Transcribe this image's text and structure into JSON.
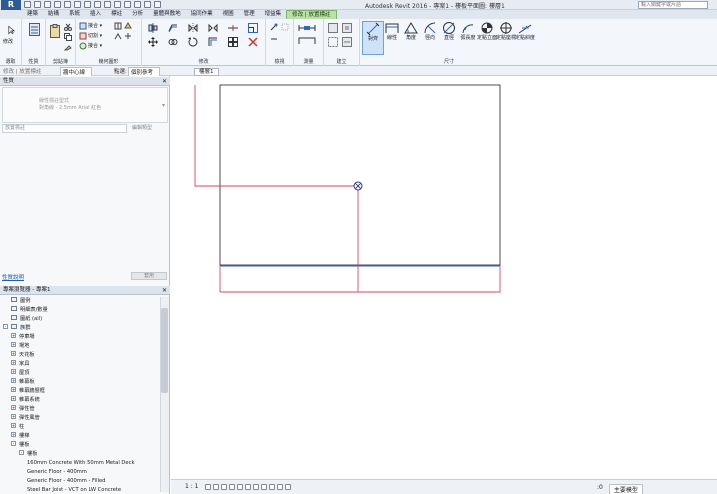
{
  "app": {
    "logo": "R",
    "title": "Autodesk Revit 2016 -    專案1 - 樓板平面圖: 樓層1",
    "search_placeholder": "輸入關鍵字或片語"
  },
  "ribbon_tabs": [
    "建築",
    "結構",
    "系統",
    "插入",
    "標註",
    "分析",
    "量體與敷地",
    "協同作業",
    "視圖",
    "管理",
    "增益集",
    "修改 | 放置標註"
  ],
  "ribbon_groups": {
    "select": "選取",
    "properties": "性質",
    "clipboard": "剪貼簿",
    "geometry": "幾何圖形",
    "modify": "修改",
    "view": "檢視",
    "measure": "測量",
    "create": "建立",
    "dimension": "尺寸"
  },
  "ribbon_buttons": {
    "modify": "修改",
    "properties": "性質",
    "aligned": "對齊",
    "linear": "線性",
    "angular": "角度",
    "radial": "徑向",
    "diameter": "直徑",
    "arc_length": "弧長度",
    "spot_elevation": "定點立面",
    "spot_coordinate": "定點座標",
    "spot_slope": "定點斜度"
  },
  "options_bar": {
    "context": "修改 | 放置標註",
    "reference": "牆中心線",
    "pick_label": "點選:",
    "pick_value": "個別參考"
  },
  "view_tab": "樓層1",
  "properties_panel": {
    "title": "性質",
    "type_line1": "線性標註型式",
    "type_line2": "對角線 - 2.5mm Arial 紅色",
    "filter": "放置標註",
    "edit_type": "編輯類型",
    "help_link": "性質說明",
    "apply": "套用"
  },
  "project_browser": {
    "title": "專案瀏覽器 - 專案1",
    "items": [
      {
        "label": "圖例",
        "level": 1,
        "toggle": "",
        "node": true
      },
      {
        "label": "明細表/數量",
        "level": 1,
        "toggle": "",
        "node": true
      },
      {
        "label": "圖紙 (all)",
        "level": 1,
        "toggle": "",
        "node": true
      },
      {
        "label": "族群",
        "level": 0,
        "toggle": "-",
        "node": true
      },
      {
        "label": "停車場",
        "level": 1,
        "toggle": "+",
        "node": false
      },
      {
        "label": "場地",
        "level": 1,
        "toggle": "+",
        "node": false
      },
      {
        "label": "天花板",
        "level": 1,
        "toggle": "+",
        "node": false
      },
      {
        "label": "家具",
        "level": 1,
        "toggle": "+",
        "node": false
      },
      {
        "label": "屋頂",
        "level": 1,
        "toggle": "+",
        "node": false
      },
      {
        "label": "帷幕板",
        "level": 1,
        "toggle": "+",
        "node": false
      },
      {
        "label": "帷幕牆豎框",
        "level": 1,
        "toggle": "+",
        "node": false
      },
      {
        "label": "帷幕系統",
        "level": 1,
        "toggle": "+",
        "node": false
      },
      {
        "label": "彈性管",
        "level": 1,
        "toggle": "+",
        "node": false
      },
      {
        "label": "彈性風管",
        "level": 1,
        "toggle": "+",
        "node": false
      },
      {
        "label": "柱",
        "level": 1,
        "toggle": "+",
        "node": false
      },
      {
        "label": "樓梯",
        "level": 1,
        "toggle": "+",
        "node": false
      },
      {
        "label": "樓板",
        "level": 1,
        "toggle": "-",
        "node": false
      },
      {
        "label": "樓板",
        "level": 2,
        "toggle": "-",
        "node": false
      },
      {
        "label": "160mm Concrete With 50mm Metal Deck",
        "level": 3,
        "toggle": "",
        "node": false
      },
      {
        "label": "Generic Floor - 400mm",
        "level": 3,
        "toggle": "",
        "node": false
      },
      {
        "label": "Generic Floor - 400mm - Filled",
        "level": 3,
        "toggle": "",
        "node": false
      },
      {
        "label": "Steel Bar Joist - VCT on LW Concrete",
        "level": 3,
        "toggle": "",
        "node": false
      }
    ]
  },
  "status": {
    "scale": "1 : 1",
    "model": ":0",
    "filter": "主要模型"
  }
}
